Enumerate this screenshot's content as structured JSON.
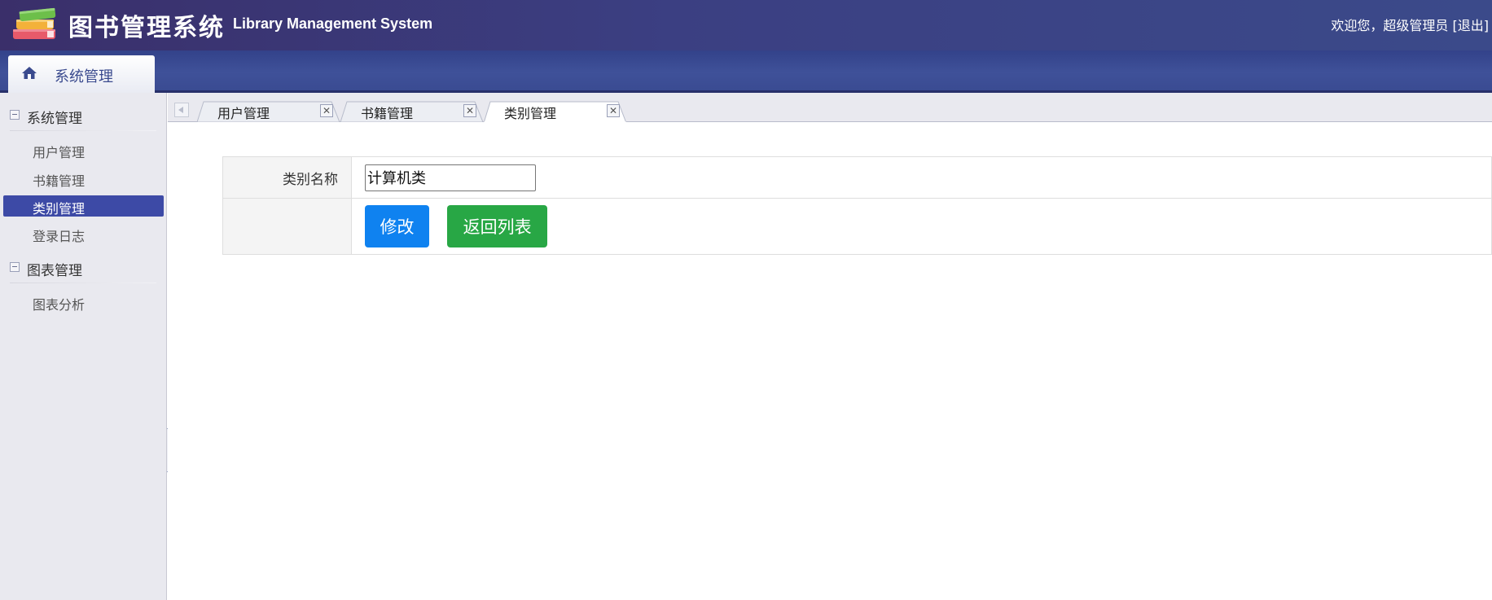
{
  "header": {
    "title_cn": "图书管理系统",
    "title_en": "Library Management System",
    "welcome": "欢迎您，超级管理员",
    "logout": "[退出]"
  },
  "nav": {
    "tab_label": "系统管理"
  },
  "sidebar": {
    "groups": [
      {
        "label": "系统管理",
        "items": [
          {
            "label": "用户管理"
          },
          {
            "label": "书籍管理"
          },
          {
            "label": "类别管理",
            "active": true
          },
          {
            "label": "登录日志"
          }
        ]
      },
      {
        "label": "图表管理",
        "items": [
          {
            "label": "图表分析"
          }
        ]
      }
    ]
  },
  "tabs": [
    {
      "label": "用户管理",
      "close": "✕"
    },
    {
      "label": "书籍管理",
      "close": "✕"
    },
    {
      "label": "类别管理",
      "close": "✕",
      "active": true
    }
  ],
  "form": {
    "category_label": "类别名称",
    "category_value": "计算机类",
    "submit_label": "修改",
    "back_label": "返回列表"
  },
  "colors": {
    "header_bg": "#3b3f82",
    "active_item": "#3d4aa6",
    "primary": "#0f82f0",
    "success": "#28a745"
  }
}
